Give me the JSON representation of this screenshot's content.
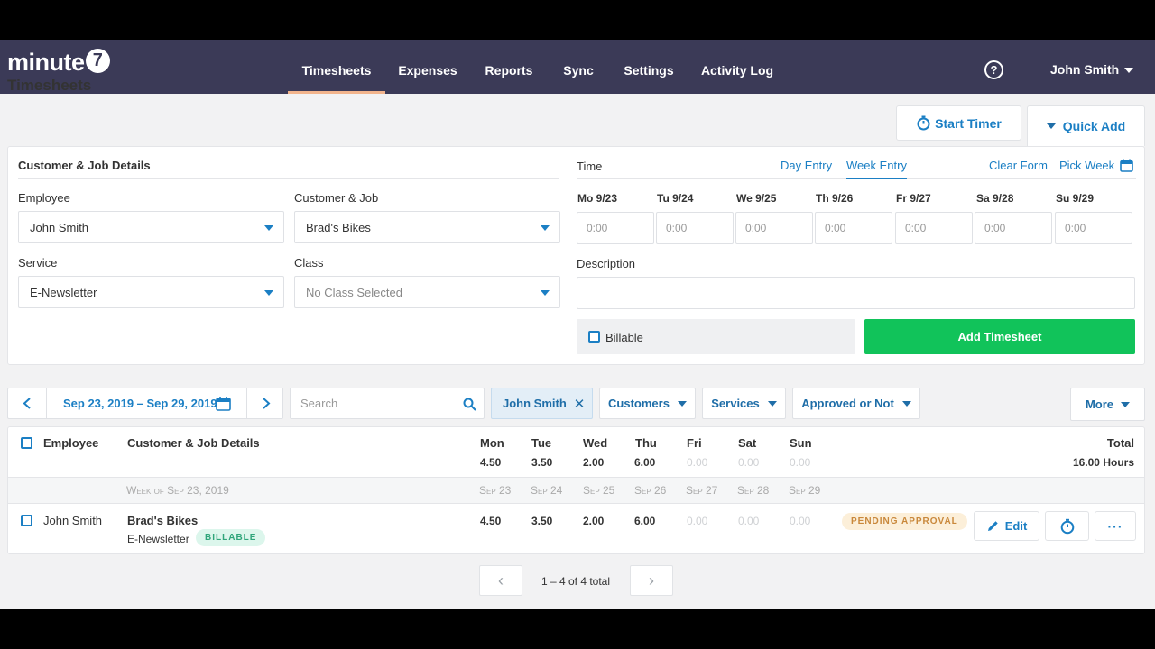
{
  "nav": {
    "logo": "minute",
    "logo_mark": "7",
    "items": [
      "Timesheets",
      "Expenses",
      "Reports",
      "Sync",
      "Settings",
      "Activity Log"
    ],
    "active": "Timesheets",
    "help_icon": "?",
    "user": "John Smith"
  },
  "page": {
    "title": "Timesheets",
    "start_timer": "Start Timer",
    "quick_add": "Quick Add"
  },
  "form": {
    "details_header": "Customer & Job Details",
    "employee_label": "Employee",
    "employee_value": "John Smith",
    "customer_label": "Customer & Job",
    "customer_value": "Brad's Bikes",
    "service_label": "Service",
    "service_value": "E-Newsletter",
    "class_label": "Class",
    "class_value": "No Class Selected",
    "time_header": "Time",
    "day_entry": "Day Entry",
    "week_entry": "Week Entry",
    "clear_form": "Clear Form",
    "pick_week": "Pick Week",
    "days": [
      "Mo 9/23",
      "Tu 9/24",
      "We 9/25",
      "Th 9/26",
      "Fr 9/27",
      "Sa 9/28",
      "Su 9/29"
    ],
    "time_placeholder": "0:00",
    "description_label": "Description",
    "billable_label": "Billable",
    "add_button": "Add Timesheet"
  },
  "filters": {
    "date_range": "Sep 23, 2019 – Sep 29, 2019",
    "search_placeholder": "Search",
    "user_chip": "John Smith",
    "customers": "Customers",
    "services": "Services",
    "approval": "Approved or Not",
    "more": "More"
  },
  "table": {
    "headers": {
      "employee": "Employee",
      "details": "Customer & Job Details",
      "total": "Total"
    },
    "days": [
      "Mon",
      "Tue",
      "Wed",
      "Thu",
      "Fri",
      "Sat",
      "Sun"
    ],
    "day_totals": [
      "4.50",
      "3.50",
      "2.00",
      "6.00",
      "0.00",
      "0.00",
      "0.00"
    ],
    "total_hours": "16.00 Hours",
    "week_label": "Week of Sep 23, 2019",
    "week_dates": [
      "Sep 23",
      "Sep 24",
      "Sep 25",
      "Sep 26",
      "Sep 27",
      "Sep 28",
      "Sep 29"
    ],
    "row": {
      "employee": "John Smith",
      "customer": "Brad's Bikes",
      "service": "E-Newsletter",
      "billable_badge": "BILLABLE",
      "hours": [
        "4.50",
        "3.50",
        "2.00",
        "6.00",
        "0.00",
        "0.00",
        "0.00"
      ],
      "status": "PENDING APPROVAL",
      "edit": "Edit",
      "more": "···"
    }
  },
  "pagination": {
    "text": "1 – 4 of 4 total",
    "prev": "‹",
    "next": "›"
  },
  "colors": {
    "nav_bg": "#3b3a57",
    "accent": "#1b7fc4",
    "green": "#11c35a",
    "nav_active_underline": "#f2b48c"
  }
}
